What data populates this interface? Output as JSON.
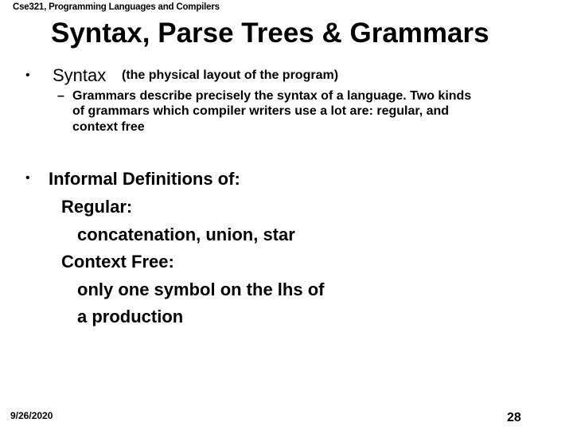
{
  "header": {
    "course": "Cse321, Programming Languages and Compilers"
  },
  "slide": {
    "title": "Syntax, Parse Trees & Grammars",
    "bullet_glyph": "•",
    "dash_glyph": "–",
    "bullet1": {
      "main": "Syntax",
      "paren": "(the physical layout of the program)",
      "sub_lines": [
        "Grammars describe precisely the syntax of a language. Two kinds",
        "of grammars which compiler writers use  a lot are: regular, and",
        "context free"
      ]
    },
    "bullet2": {
      "main": "Informal Definitions of:",
      "regular_label": "Regular:",
      "regular_desc": "concatenation, union, star",
      "cf_label": "Context Free:",
      "cf_desc_lines": [
        "only one symbol on the lhs of",
        "a production"
      ]
    }
  },
  "footer": {
    "date": "9/26/2020",
    "page": "28"
  }
}
